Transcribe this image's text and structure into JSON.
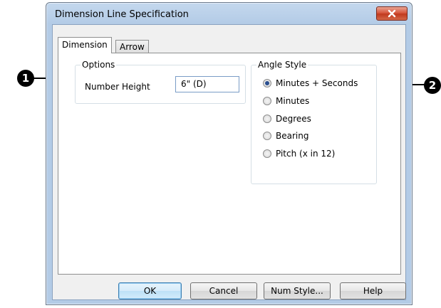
{
  "window": {
    "title": "Dimension Line Specification"
  },
  "tabs": [
    {
      "label": "Dimension",
      "active": true
    },
    {
      "label": "Arrow",
      "active": false
    }
  ],
  "options_group": {
    "legend": "Options",
    "number_height_label": "Number Height",
    "number_height_value": "6\" (D)"
  },
  "angle_style_group": {
    "legend": "Angle Style",
    "options": [
      {
        "label": "Minutes + Seconds",
        "selected": true
      },
      {
        "label": "Minutes",
        "selected": false
      },
      {
        "label": "Degrees",
        "selected": false
      },
      {
        "label": "Bearing",
        "selected": false
      },
      {
        "label": "Pitch (x in 12)",
        "selected": false
      }
    ]
  },
  "buttons": {
    "ok": "OK",
    "cancel": "Cancel",
    "num_style": "Num Style...",
    "help": "Help"
  },
  "callouts": [
    "1",
    "2"
  ],
  "colors": {
    "title_bar": "#b3cbe6",
    "close_button": "#c13a1e",
    "callout": "#000000"
  }
}
